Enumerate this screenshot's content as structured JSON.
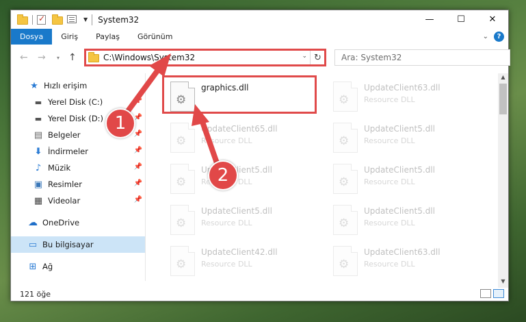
{
  "title_bar": {
    "title": "System32",
    "minimize": "—",
    "maximize": "☐",
    "close": "✕"
  },
  "ribbon": {
    "tabs": [
      "Dosya",
      "Giriş",
      "Paylaş",
      "Görünüm"
    ],
    "collapse_icon": "chevron-down-icon",
    "help": "?"
  },
  "address": {
    "path": "C:\\Windows\\System32",
    "refresh": "↻",
    "search_placeholder": "Ara: System32"
  },
  "nav": {
    "back": "←",
    "forward": "→",
    "recent": "▾",
    "up": "↑"
  },
  "sidebar": {
    "items": [
      {
        "label": "Hızlı erişim",
        "icon": "star-icon"
      },
      {
        "label": "Yerel Disk (C:)",
        "icon": "drive-icon"
      },
      {
        "label": "Yerel Disk (D:)",
        "icon": "drive-icon"
      },
      {
        "label": "Belgeler",
        "icon": "documents-icon"
      },
      {
        "label": "İndirmeler",
        "icon": "download-icon"
      },
      {
        "label": "Müzik",
        "icon": "music-icon"
      },
      {
        "label": "Resimler",
        "icon": "pictures-icon"
      },
      {
        "label": "Videolar",
        "icon": "videos-icon"
      },
      {
        "label": "OneDrive",
        "icon": "cloud-icon"
      },
      {
        "label": "Bu bilgisayar",
        "icon": "computer-icon"
      },
      {
        "label": "Ağ",
        "icon": "network-icon"
      }
    ]
  },
  "files": {
    "selected": {
      "name": "graphics.dll",
      "type": ""
    },
    "tiles": [
      {
        "name": "UpdateClient63.dll",
        "type": "Resource DLL"
      },
      {
        "name": "UpdateClient65.dll",
        "type": "Resource DLL"
      },
      {
        "name": "UpdateClient5.dll",
        "type": "Resource DLL"
      },
      {
        "name": "UpdateClient5.dll",
        "type": "Resource DLL"
      },
      {
        "name": "UpdateClient5.dll",
        "type": "Resource DLL"
      },
      {
        "name": "UpdateClient5.dll",
        "type": "Resource DLL"
      },
      {
        "name": "UpdateClient5.dll",
        "type": "Resource DLL"
      },
      {
        "name": "UpdateClient42.dll",
        "type": "Resource DLL"
      },
      {
        "name": "UpdateClient63.dll",
        "type": "Resource DLL"
      }
    ]
  },
  "status": {
    "count": "121 öğe"
  },
  "annotations": {
    "step1": "1",
    "step2": "2",
    "color": "#e14848"
  }
}
